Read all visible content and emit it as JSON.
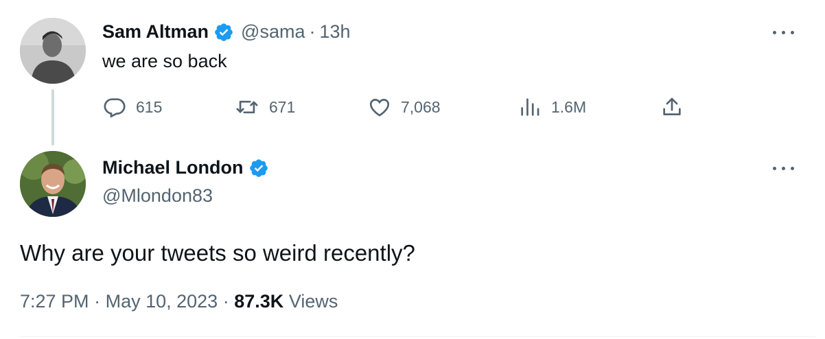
{
  "tweet": {
    "author_name": "Sam Altman",
    "author_handle": "@sama",
    "time_separator": "·",
    "time_ago": "13h",
    "text": "we are so back",
    "actions": {
      "replies": "615",
      "retweets": "671",
      "likes": "7,068",
      "views": "1.6M"
    }
  },
  "reply": {
    "author_name": "Michael London",
    "author_handle": "@Mlondon83",
    "text": "Why are your tweets so weird recently?",
    "time": "7:27 PM",
    "sep1": "·",
    "date": "May 10, 2023",
    "sep2": "·",
    "views_count": "87.3K",
    "views_label": "Views"
  },
  "colors": {
    "verified": "#1d9bf0",
    "secondary_text": "#536471",
    "primary_text": "#0f1419"
  },
  "icons": [
    "verified-badge-icon",
    "more-icon",
    "reply-icon",
    "retweet-icon",
    "like-icon",
    "views-icon",
    "share-icon"
  ]
}
